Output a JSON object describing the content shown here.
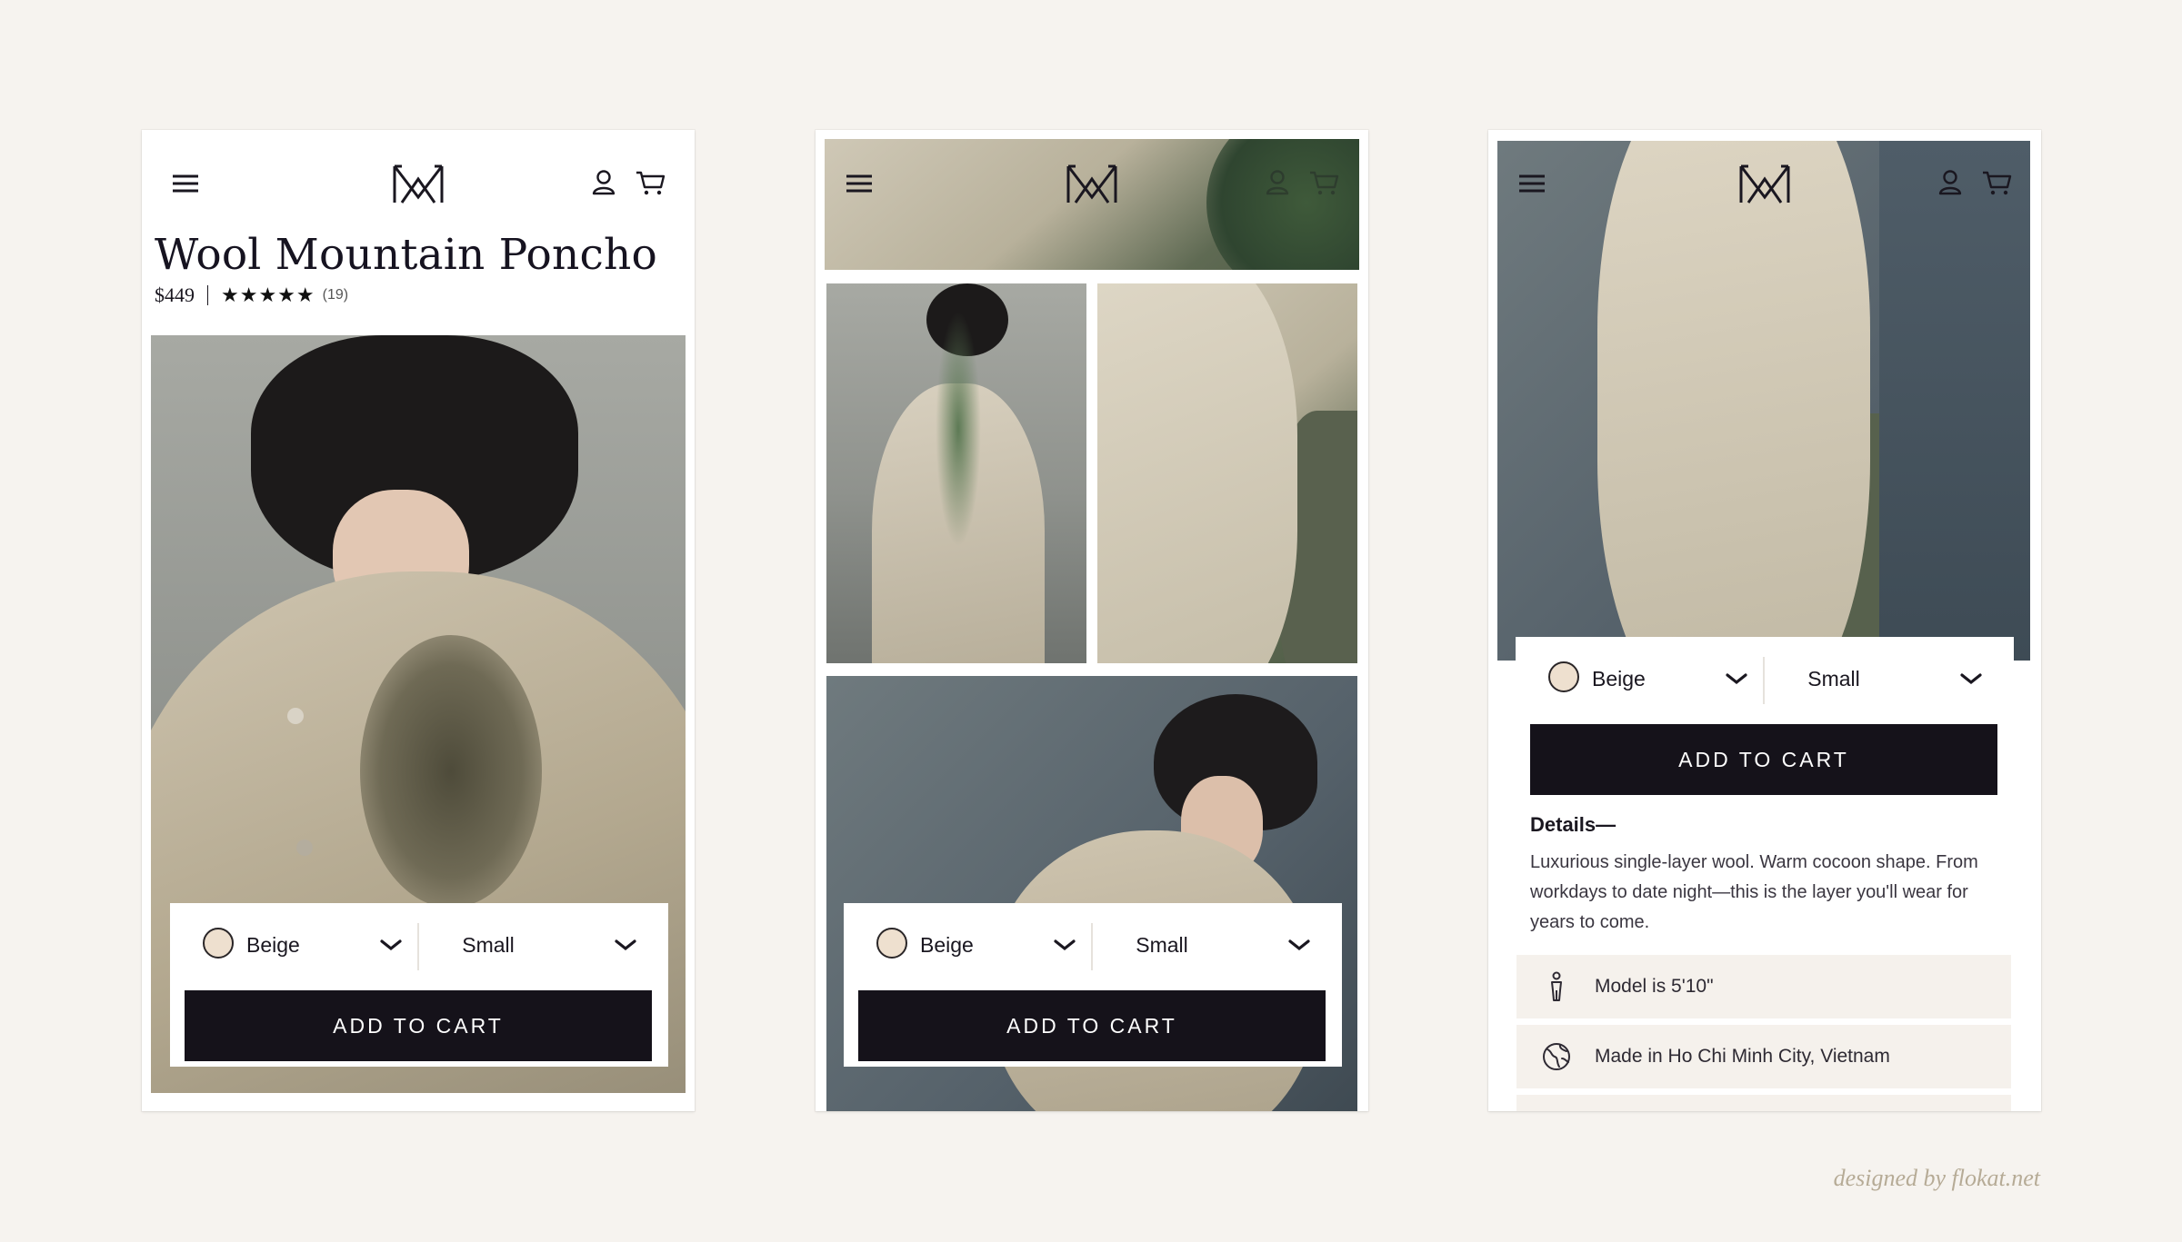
{
  "product": {
    "name": "Wool Mountain Poncho",
    "price": "$449",
    "rating_stars": "★★★★★",
    "rating": 5,
    "reviews": "(19)"
  },
  "nav": {
    "menu_icon": "hamburger-menu-icon",
    "logo_icon": "brand-logo-icon",
    "account_icon": "user-account-icon",
    "cart_icon": "shopping-cart-icon"
  },
  "buybox": {
    "color_value": "Beige",
    "color_swatch": "#eee0cf",
    "size_value": "Small",
    "add_to_cart": "ADD TO CART",
    "button_color": "#15121a"
  },
  "details": {
    "heading": "Details—",
    "text": "Luxurious single-layer wool. Warm cocoon shape. From workdays to date night—this is the layer you'll wear for years to come.",
    "items": [
      {
        "icon": "person-figure-icon",
        "text": "Model is 5'10\""
      },
      {
        "icon": "globe-icon",
        "text": "Made in Ho Chi Minh City, Vietnam"
      }
    ]
  },
  "credit": "designed by flokat.net",
  "colors": {
    "background": "#f6f3ef",
    "panel": "#ffffff",
    "accent_text": "#b6ab96"
  }
}
